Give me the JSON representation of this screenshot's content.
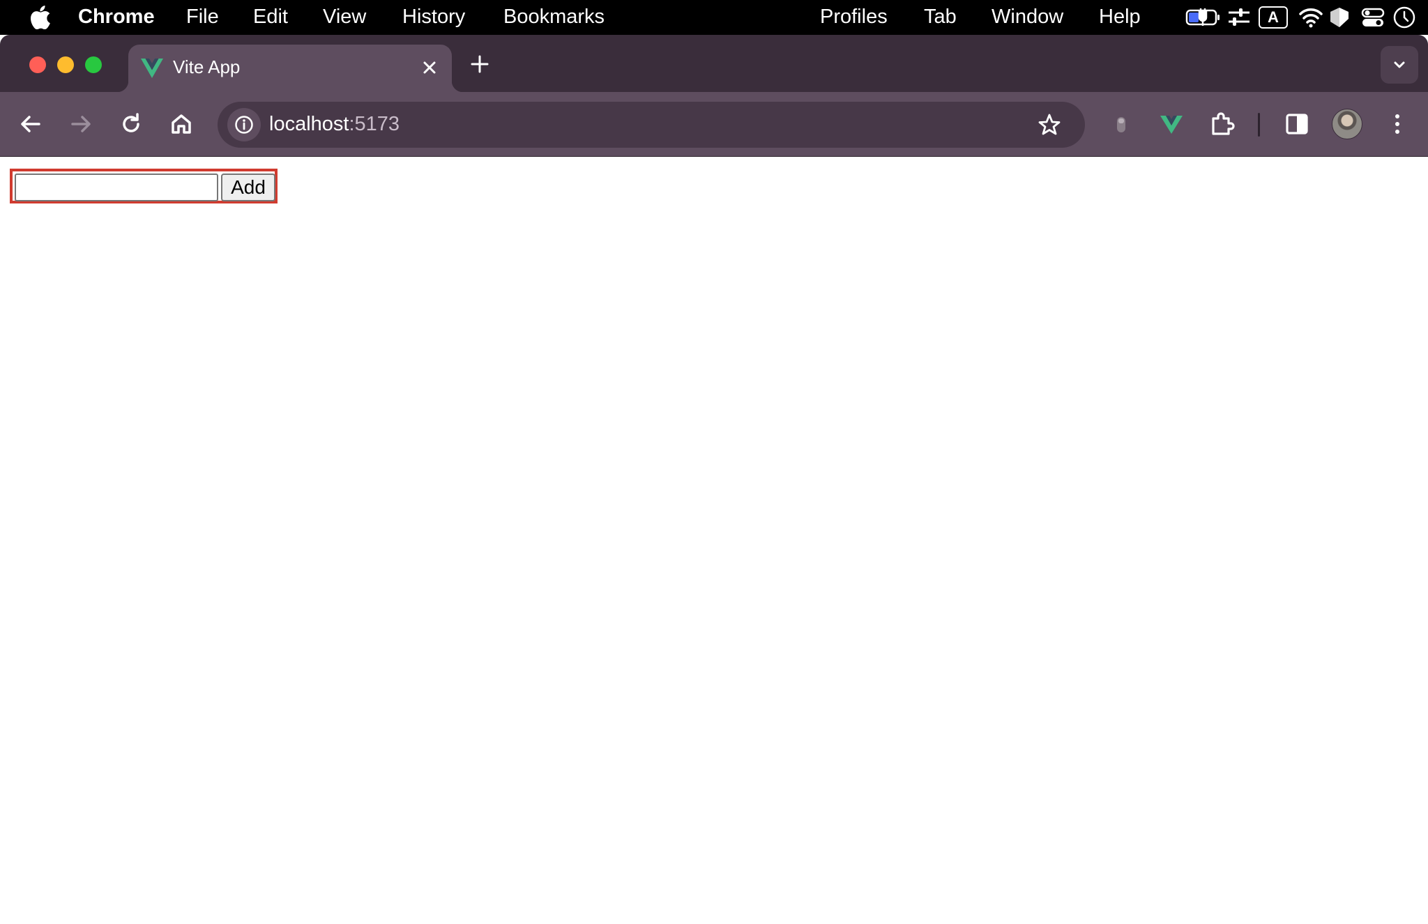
{
  "menubar": {
    "app_name": "Chrome",
    "items": [
      "File",
      "Edit",
      "View",
      "History",
      "Bookmarks"
    ],
    "right_items": [
      "Profiles",
      "Tab",
      "Window",
      "Help"
    ],
    "status_icons": [
      "battery-charging-icon",
      "control-sliders-icon",
      "input-source-icon",
      "wifi-icon",
      "shield-icon",
      "control-center-icon",
      "clock-icon"
    ],
    "input_source_label": "A"
  },
  "browser": {
    "tab": {
      "title": "Vite App",
      "favicon": "vue-logo-icon"
    },
    "address": {
      "host": "localhost",
      "port": ":5173"
    },
    "colors": {
      "tabstrip": "#3a2d3b",
      "toolbar": "#5e4d5f",
      "omnibox": "#473848",
      "vue_green": "#41b883"
    }
  },
  "page": {
    "input": {
      "value": "",
      "placeholder": ""
    },
    "add_button_label": "Add",
    "highlight_color": "#d03b2f"
  }
}
